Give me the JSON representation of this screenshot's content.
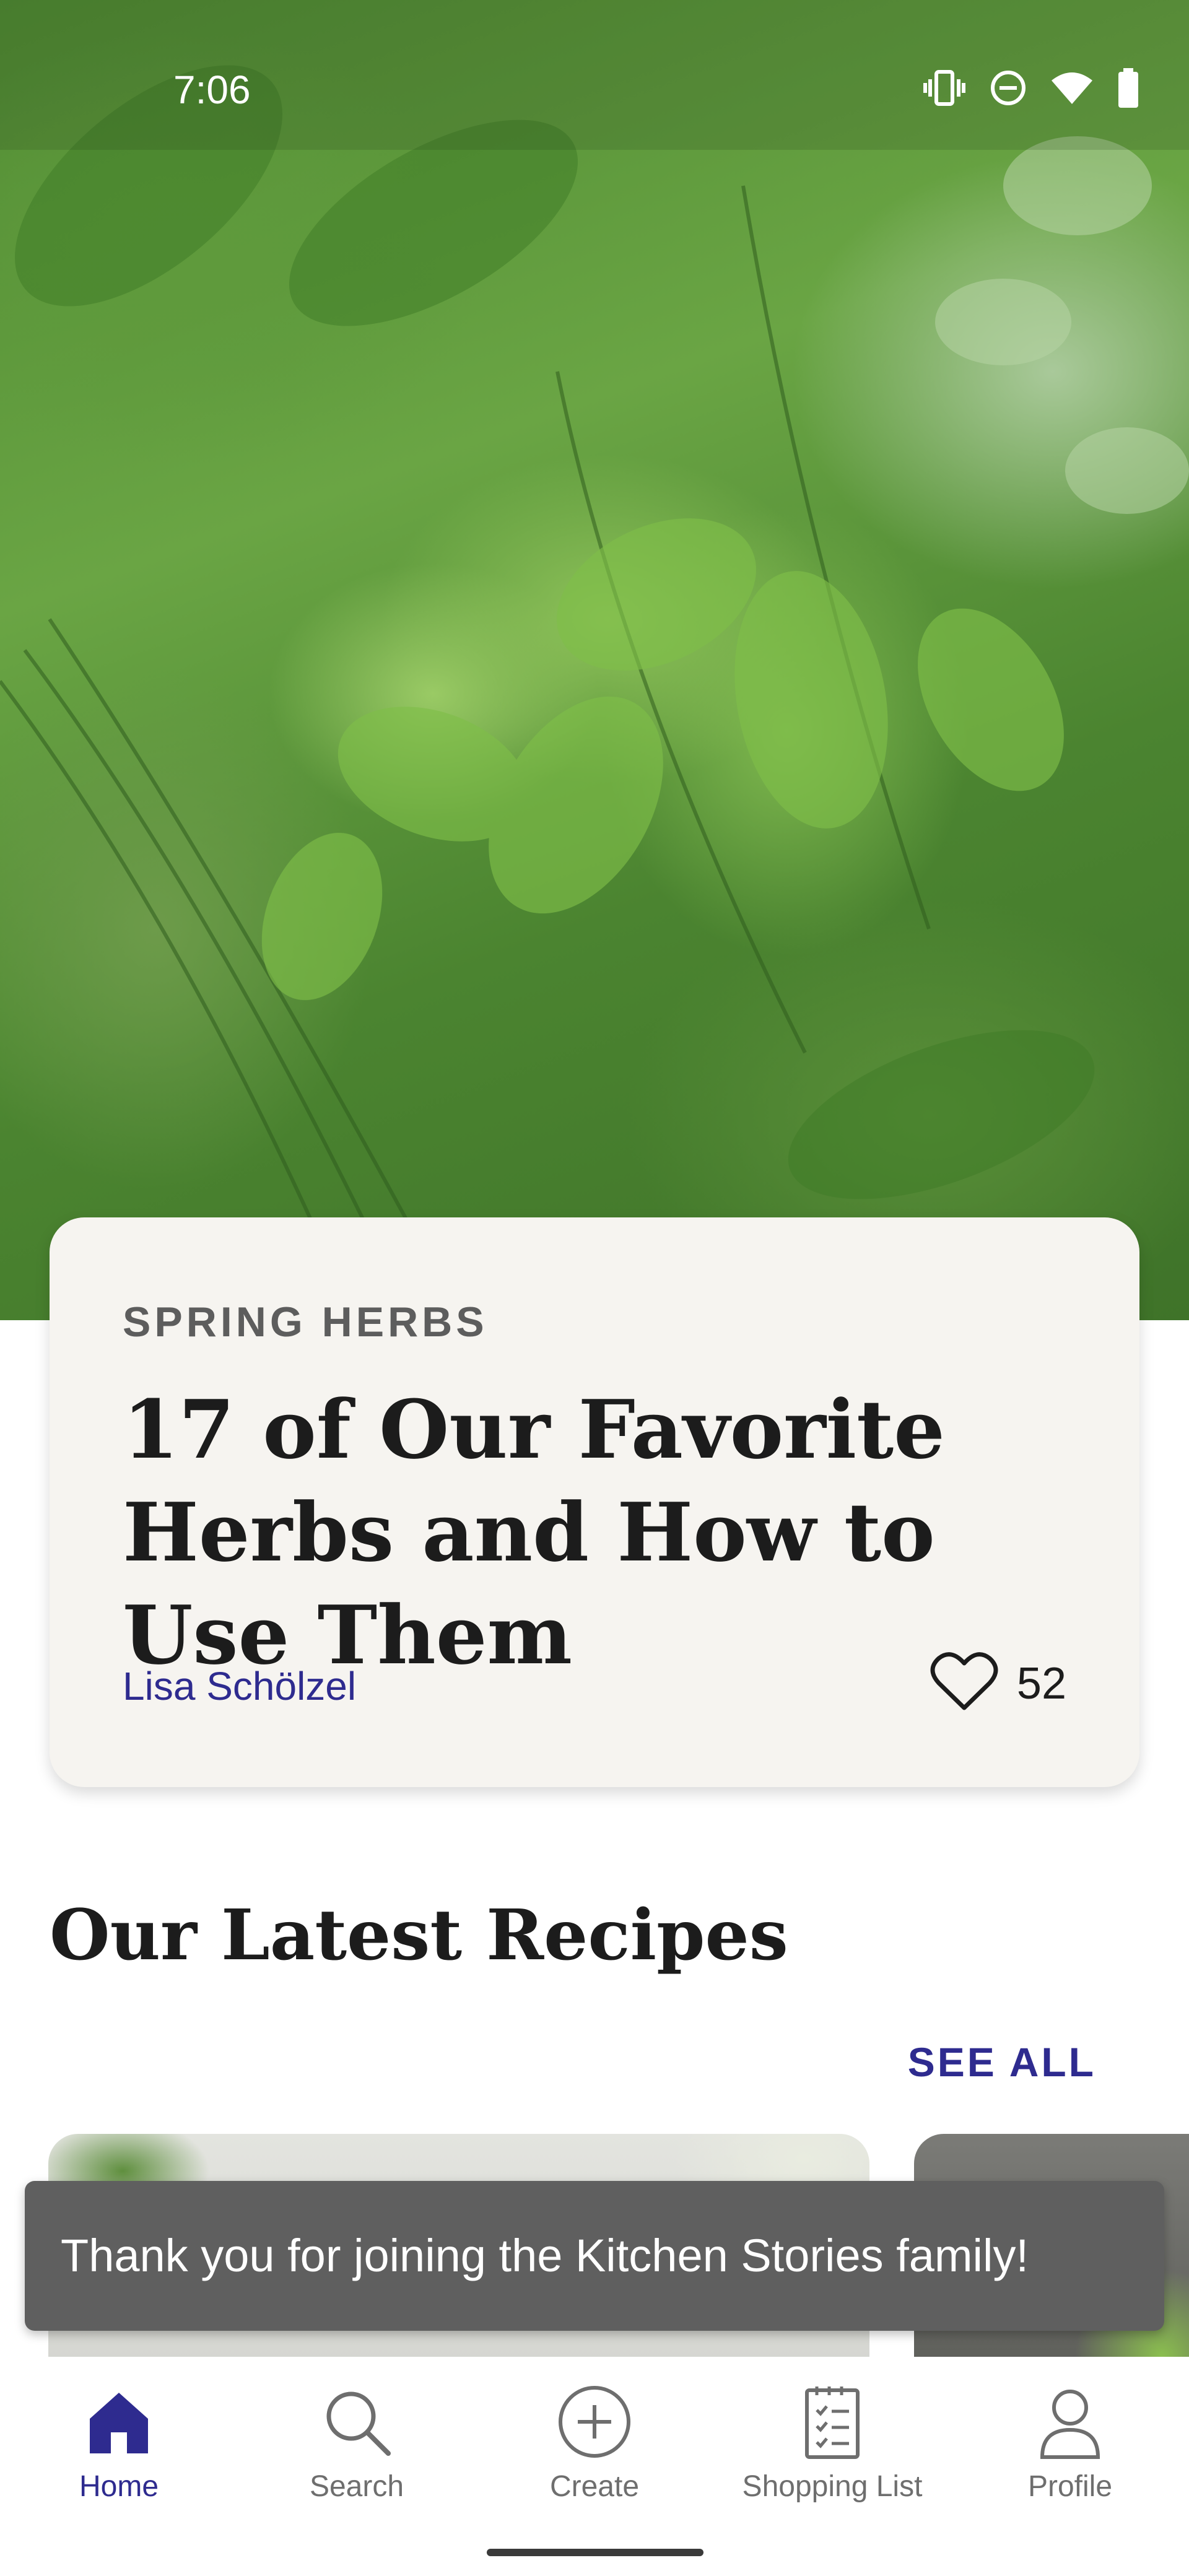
{
  "status_bar": {
    "time": "7:06",
    "icons": [
      "vibrate-icon",
      "do-not-disturb-icon",
      "wifi-icon",
      "battery-icon"
    ]
  },
  "hero": {
    "image": "fresh-herbs-photo"
  },
  "feature": {
    "kicker": "SPRING HERBS",
    "title": "17 of Our Favorite Herbs and How to Use Them",
    "author": "Lisa Schölzel",
    "likes": "52",
    "like_icon": "heart-icon"
  },
  "latest": {
    "title": "Our Latest Recipes",
    "see_all": "SEE ALL"
  },
  "snackbar": {
    "message": "Thank you for joining the Kitchen Stories family!"
  },
  "bottom_nav": {
    "items": [
      {
        "label": "Home",
        "icon": "home-icon",
        "active": true
      },
      {
        "label": "Search",
        "icon": "search-icon",
        "active": false
      },
      {
        "label": "Create",
        "icon": "add-circle-icon",
        "active": false
      },
      {
        "label": "Shopping List",
        "icon": "shopping-list-icon",
        "active": false
      },
      {
        "label": "Profile",
        "icon": "profile-icon",
        "active": false
      }
    ]
  },
  "colors": {
    "accent": "#2e2b8f",
    "card_bg": "#f6f4f0",
    "snackbar_bg": "#5f5f5f"
  }
}
